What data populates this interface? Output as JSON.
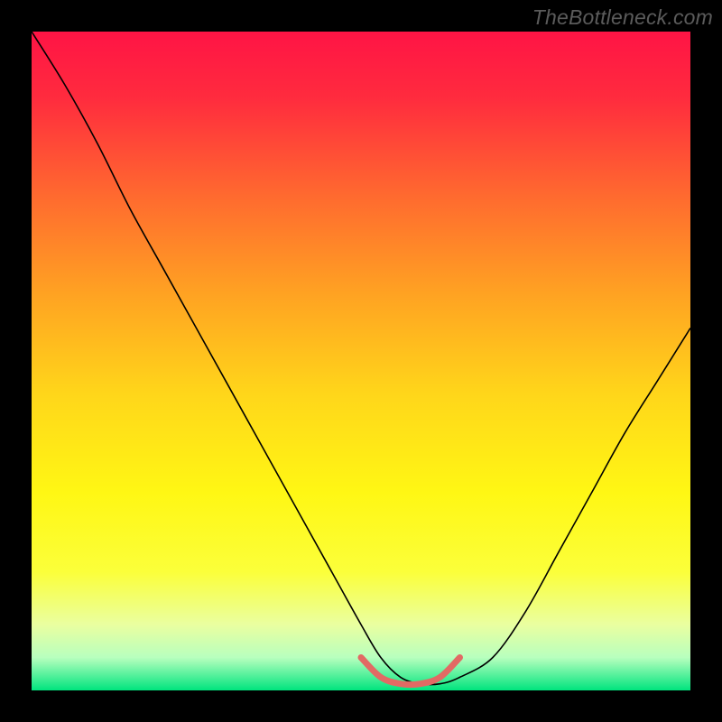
{
  "watermark_text": "TheBottleneck.com",
  "chart_data": {
    "type": "line",
    "title": "",
    "xlabel": "",
    "ylabel": "",
    "x_range": [
      0,
      100
    ],
    "y_range": [
      0,
      100
    ],
    "background": {
      "type": "vertical_gradient",
      "stops": [
        {
          "pos": 0.0,
          "color": "#ff1445"
        },
        {
          "pos": 0.1,
          "color": "#ff2b3e"
        },
        {
          "pos": 0.25,
          "color": "#ff6a2f"
        },
        {
          "pos": 0.4,
          "color": "#ffa322"
        },
        {
          "pos": 0.55,
          "color": "#ffd61a"
        },
        {
          "pos": 0.7,
          "color": "#fff714"
        },
        {
          "pos": 0.82,
          "color": "#fbff3a"
        },
        {
          "pos": 0.9,
          "color": "#eaffa0"
        },
        {
          "pos": 0.95,
          "color": "#b8ffbe"
        },
        {
          "pos": 1.0,
          "color": "#00e47e"
        }
      ]
    },
    "series": [
      {
        "name": "bottleneck_curve",
        "stroke": "#000000",
        "stroke_width": 1.6,
        "x": [
          0,
          5,
          10,
          15,
          20,
          25,
          30,
          35,
          40,
          45,
          50,
          53,
          56,
          59,
          62,
          65,
          70,
          75,
          80,
          85,
          90,
          95,
          100
        ],
        "values": [
          100,
          92,
          83,
          73,
          64,
          55,
          46,
          37,
          28,
          19,
          10,
          5,
          2,
          1,
          1,
          2,
          5,
          12,
          21,
          30,
          39,
          47,
          55
        ]
      },
      {
        "name": "optimal_band",
        "stroke": "#e26a64",
        "stroke_width": 7,
        "linecap": "round",
        "x": [
          50,
          53,
          56,
          59,
          62,
          65
        ],
        "values": [
          5,
          2,
          1,
          1,
          2,
          5
        ]
      }
    ]
  }
}
